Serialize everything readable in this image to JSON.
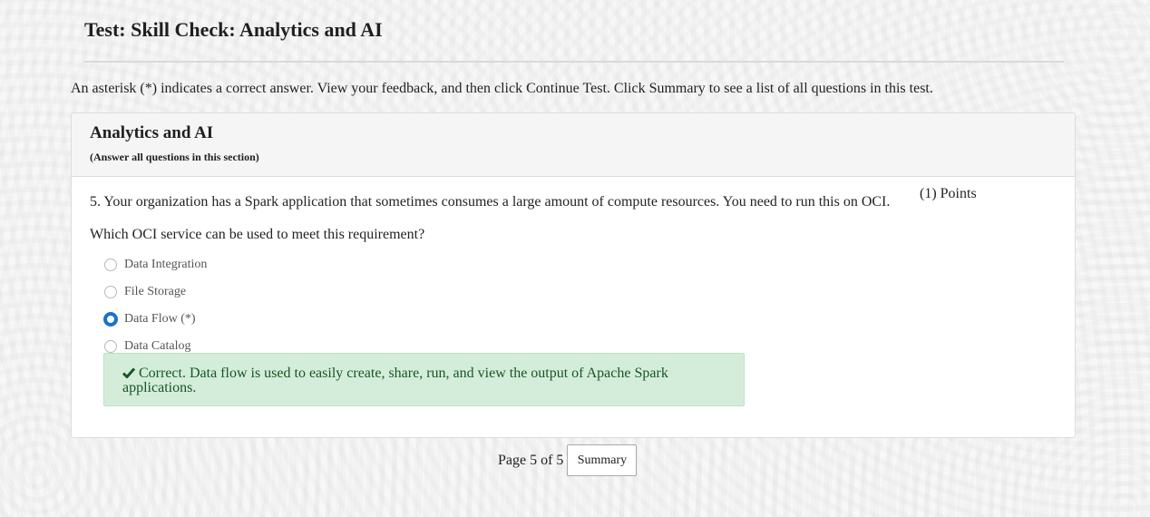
{
  "page": {
    "title": "Test: Skill Check: Analytics and AI",
    "instructions": "An asterisk (*) indicates a correct answer. View your feedback, and then click Continue Test. Click Summary to see a list of all questions in this test."
  },
  "section": {
    "title": "Analytics and AI",
    "note": "(Answer all questions in this section)"
  },
  "question": {
    "text": "5. Your organization has a Spark application that sometimes consumes a large amount of compute resources. You need to run this on OCI.",
    "points": "(1) Points",
    "prompt": "Which OCI service can be used to meet this requirement?",
    "options": [
      {
        "label": "Data Integration",
        "selected": false
      },
      {
        "label": "File Storage",
        "selected": false
      },
      {
        "label": "Data Flow (*)",
        "selected": true
      },
      {
        "label": "Data Catalog",
        "selected": false
      }
    ],
    "feedback": "Correct. Data flow is used to easily create, share, run, and view the output of Apache Spark applications.",
    "feedback_icon": "check-icon"
  },
  "footer": {
    "page_label": "Page 5 of 5",
    "summary_label": "Summary"
  },
  "colors": {
    "radio_selected": "#1a73c9",
    "feedback_bg": "#d4edda",
    "feedback_text": "#155724"
  }
}
